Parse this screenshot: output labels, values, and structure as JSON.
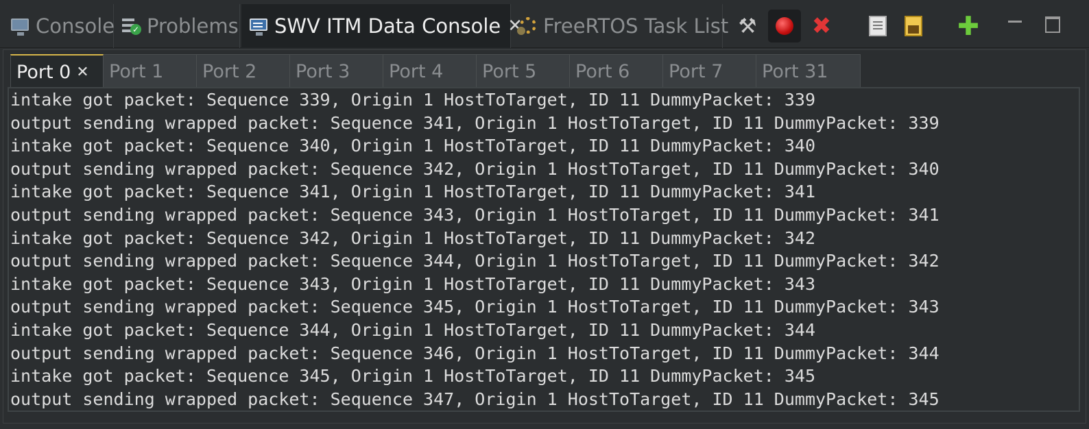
{
  "view_tabs": {
    "console": "Console",
    "problems": "Problems",
    "swv": "SWV ITM Data Console",
    "freertos": "FreeRTOS Task List"
  },
  "icons": {
    "console": "monitor-icon",
    "problems": "problems-icon",
    "swv": "monitor-icon",
    "freertos": "gear-icon",
    "toolbar": [
      "tools-icon",
      "record-icon",
      "delete-icon",
      "export-icon",
      "lock-icon",
      "add-icon",
      "minimize-icon",
      "maximize-icon"
    ]
  },
  "ports": [
    "Port 0",
    "Port 1",
    "Port 2",
    "Port 3",
    "Port 4",
    "Port 5",
    "Port 6",
    "Port 7",
    "Port 31"
  ],
  "console_lines": [
    "intake got packet: Sequence 339, Origin 1 HostToTarget, ID 11 DummyPacket: 339",
    "output sending wrapped packet: Sequence 341, Origin 1 HostToTarget, ID 11 DummyPacket: 339",
    "intake got packet: Sequence 340, Origin 1 HostToTarget, ID 11 DummyPacket: 340",
    "output sending wrapped packet: Sequence 342, Origin 1 HostToTarget, ID 11 DummyPacket: 340",
    "intake got packet: Sequence 341, Origin 1 HostToTarget, ID 11 DummyPacket: 341",
    "output sending wrapped packet: Sequence 343, Origin 1 HostToTarget, ID 11 DummyPacket: 341",
    "intake got packet: Sequence 342, Origin 1 HostToTarget, ID 11 DummyPacket: 342",
    "output sending wrapped packet: Sequence 344, Origin 1 HostToTarget, ID 11 DummyPacket: 342",
    "intake got packet: Sequence 343, Origin 1 HostToTarget, ID 11 DummyPacket: 343",
    "output sending wrapped packet: Sequence 345, Origin 1 HostToTarget, ID 11 DummyPacket: 343",
    "intake got packet: Sequence 344, Origin 1 HostToTarget, ID 11 DummyPacket: 344",
    "output sending wrapped packet: Sequence 346, Origin 1 HostToTarget, ID 11 DummyPacket: 344",
    "intake got packet: Sequence 345, Origin 1 HostToTarget, ID 11 DummyPacket: 345",
    "output sending wrapped packet: Sequence 347, Origin 1 HostToTarget, ID 11 DummyPacket: 345"
  ],
  "colors": {
    "background": "#2b2e30",
    "active_tab": "#1f2224",
    "port_tab_accent": "#d7b64a",
    "record": "#c51010",
    "delete": "#e23636",
    "add": "#6ccb3c"
  }
}
